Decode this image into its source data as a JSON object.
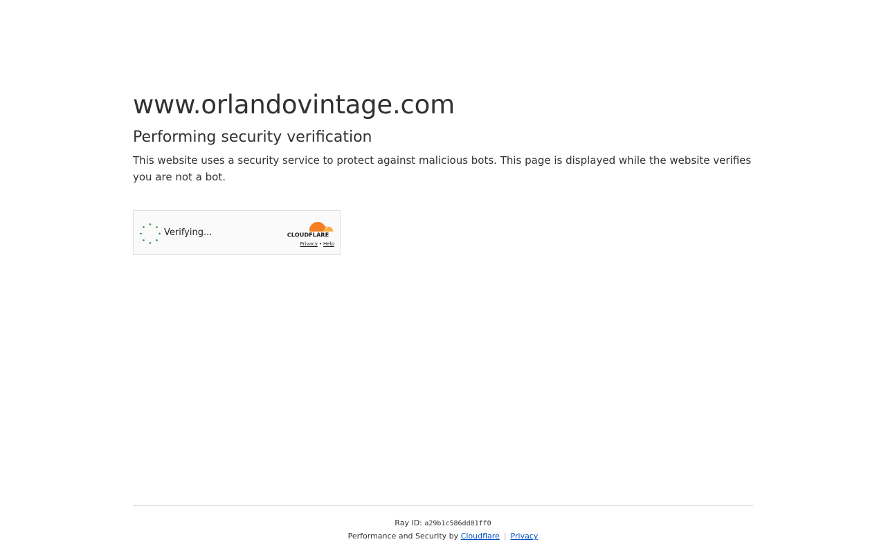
{
  "site": {
    "title": "www.orlandovintage.com"
  },
  "verification": {
    "heading": "Performing security verification",
    "description": "This website uses a security service to protect against malicious bots. This page is displayed while the website verifies you are not a bot."
  },
  "widget": {
    "status_text": "Verifying...",
    "brand": "CLOUDFLARE",
    "privacy_link": "Privacy",
    "separator": "•",
    "help_link": "Help",
    "colors": {
      "spinner": "#1e8e3e",
      "cloud_orange": "#f38020",
      "cloud_light": "#faae40"
    }
  },
  "footer": {
    "ray_label": "Ray ID:",
    "ray_id": "a29b1c586dd01ff0",
    "perf_text": "Performance and Security by",
    "cloudflare_link": "Cloudflare",
    "pipe": "|",
    "privacy_link": "Privacy",
    "link_color": "#0051c3"
  }
}
